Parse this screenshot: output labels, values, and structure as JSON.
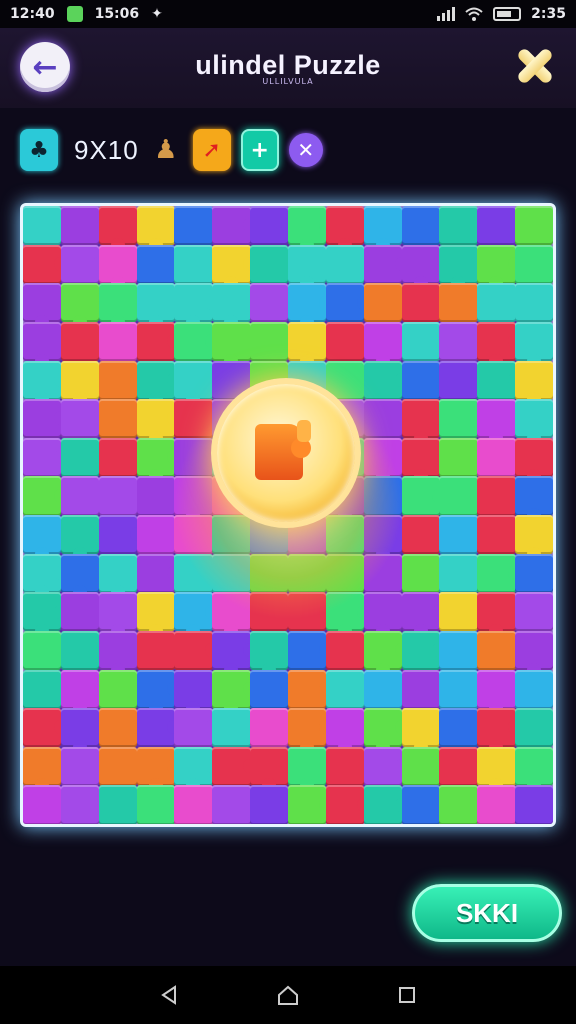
{
  "status_bar": {
    "left_time": "12:40",
    "clock_mid": "15:06",
    "right_time": "2:35"
  },
  "header": {
    "title": "ulindel Puzzle",
    "subtitle": "ULLILVULA"
  },
  "toolbar": {
    "grid_size": "9X10"
  },
  "actions": {
    "skip_label": "SKKI"
  },
  "board": {
    "rows": 16,
    "cols": 14,
    "palette": [
      "#3be07a",
      "#e6334e",
      "#2fb4e8",
      "#9b3ee0",
      "#c040e6",
      "#f2d32f",
      "#34d1c6",
      "#7a3de6",
      "#e84ccd",
      "#2e6fe8",
      "#5fe04a",
      "#f07b2a",
      "#a34ae8",
      "#24c9a8"
    ]
  },
  "colors": {
    "accent": "#8d5bf0",
    "skip": "#14c993",
    "board_border": "#e8f6ff",
    "coin": "#ffe07a"
  }
}
